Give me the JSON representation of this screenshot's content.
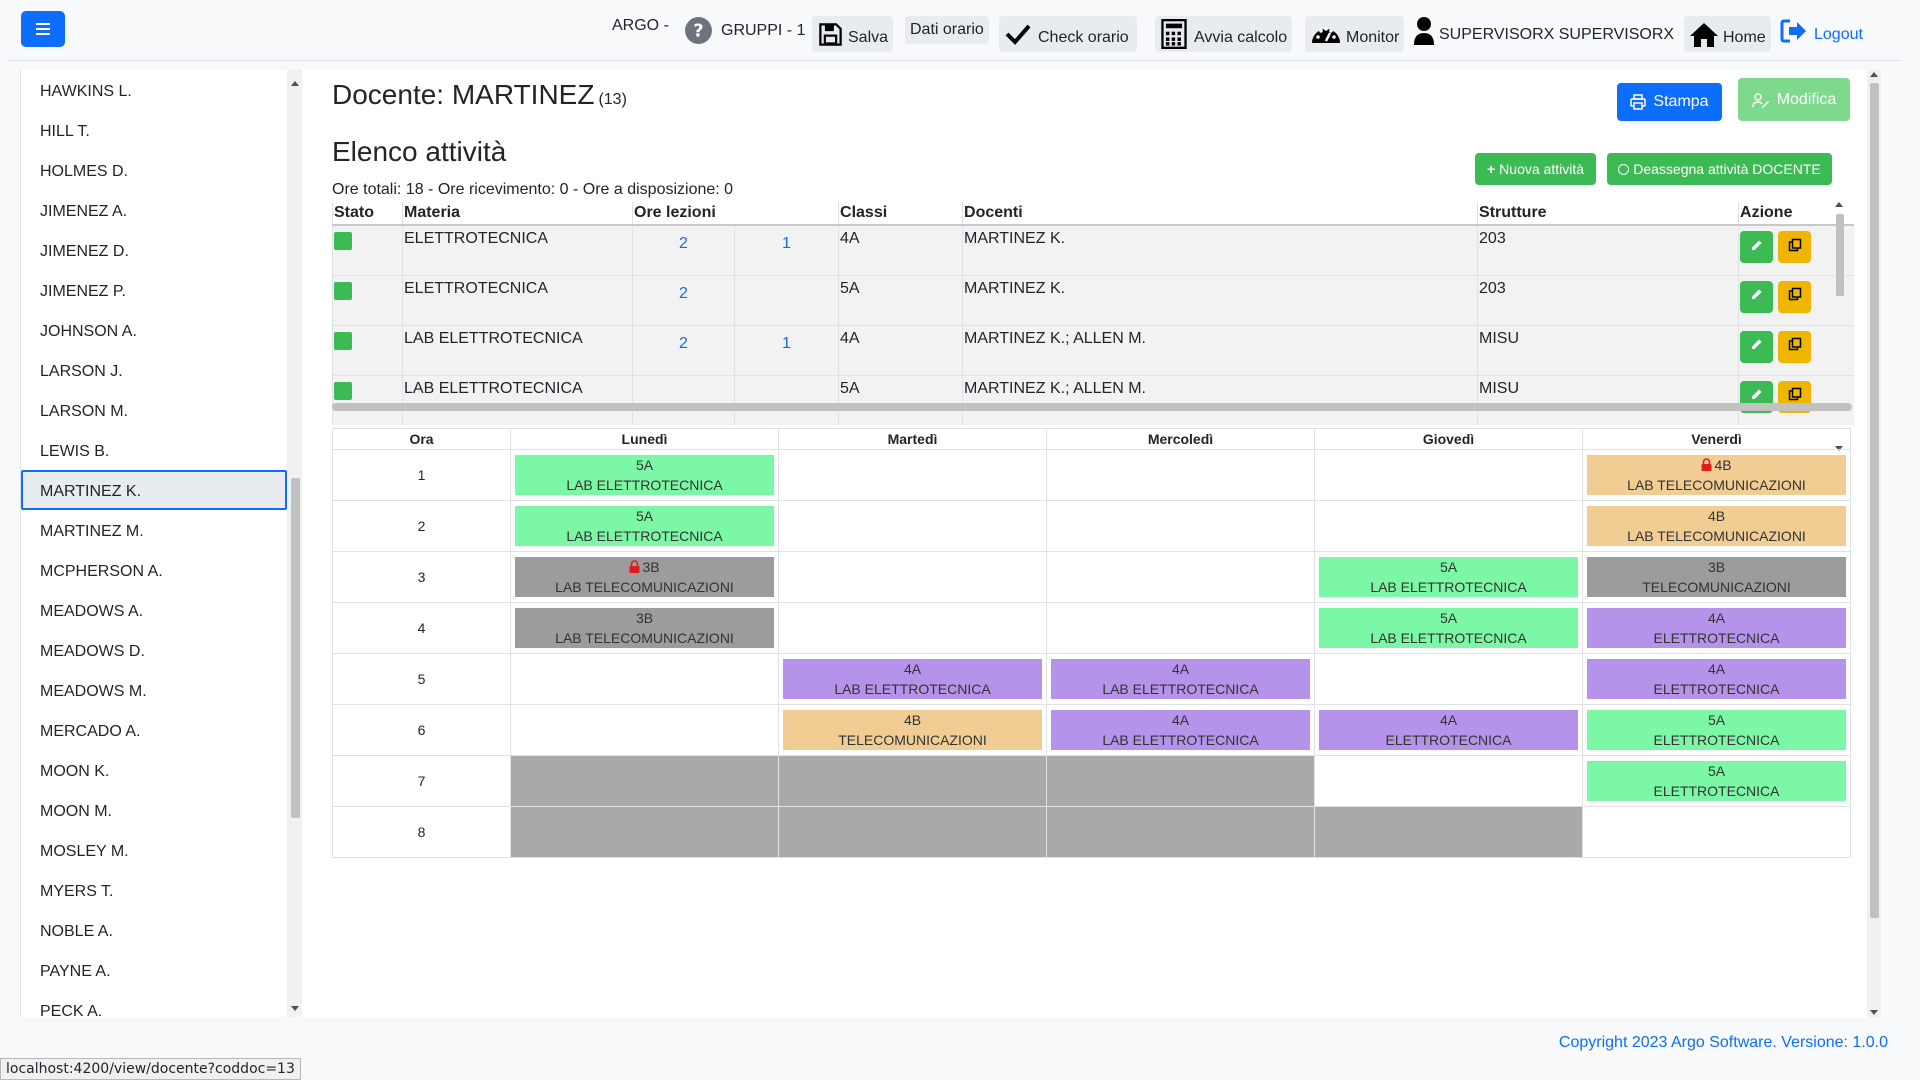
{
  "header": {
    "tenant": "ARGO -",
    "groups_label": "GRUPPI - 1",
    "save": "Salva",
    "timetable_data": "Dati orario",
    "check": "Check orario",
    "compute": "Avvia calcolo",
    "monitor": "Monitor",
    "user": "SUPERVISORX SUPERVISORX",
    "home": "Home",
    "logout": "Logout"
  },
  "sidebar": {
    "items": [
      "HAWKINS L.",
      "HILL T.",
      "HOLMES D.",
      "JIMENEZ A.",
      "JIMENEZ D.",
      "JIMENEZ P.",
      "JOHNSON A.",
      "LARSON J.",
      "LARSON M.",
      "LEWIS B.",
      "MARTINEZ K.",
      "MARTINEZ M.",
      "MCPHERSON A.",
      "MEADOWS A.",
      "MEADOWS D.",
      "MEADOWS M.",
      "MERCADO A.",
      "MOON K.",
      "MOON M.",
      "MOSLEY M.",
      "MYERS T.",
      "NOBLE A.",
      "PAYNE A.",
      "PECK A."
    ],
    "active": "MARTINEZ K."
  },
  "page": {
    "title": "Docente: MARTINEZ",
    "code": "(13)",
    "print": "Stampa",
    "edit": "Modifica",
    "section": "Elenco attività",
    "summary": "Ore totali: 18 - Ore ricevimento: 0 - Ore a disposizione: 0",
    "new_activity": "Nuova attività",
    "unassign": "Deassegna attività DOCENTE"
  },
  "activities": {
    "headers": [
      "Stato",
      "Materia",
      "Ore lezioni",
      "Classi",
      "Docenti",
      "Strutture",
      "Azione"
    ],
    "rows": [
      {
        "materia": "ELETTROTECNICA",
        "ore1": "2",
        "ore2": "1",
        "classe": "4A",
        "docenti": "MARTINEZ K.",
        "strutture": "203"
      },
      {
        "materia": "ELETTROTECNICA",
        "ore1": "2",
        "ore2": "",
        "classe": "5A",
        "docenti": "MARTINEZ K.",
        "strutture": "203"
      },
      {
        "materia": "LAB ELETTROTECNICA",
        "ore1": "2",
        "ore2": "1",
        "classe": "4A",
        "docenti": "MARTINEZ K.; ALLEN M.",
        "strutture": "MISU"
      },
      {
        "materia": "LAB ELETTROTECNICA",
        "ore1": "",
        "ore2": "",
        "classe": "5A",
        "docenti": "MARTINEZ K.; ALLEN M.",
        "strutture": "MISU"
      }
    ]
  },
  "schedule": {
    "hour_label": "Ora",
    "days": [
      "Lunedì",
      "Martedì",
      "Mercoledì",
      "Giovedì",
      "Venerdì"
    ],
    "hours": [
      "1",
      "2",
      "3",
      "4",
      "5",
      "6",
      "7",
      "8"
    ],
    "colors": {
      "green": "#7cf7a6",
      "orange": "#f2cd93",
      "gray": "#9e9b9e",
      "purple": "#b593ea",
      "blocked": "#a9a9a9"
    },
    "cells": [
      [
        {
          "c": "5A",
          "s": "LAB ELETTROTECNICA",
          "color": "green"
        },
        null,
        null,
        null,
        {
          "c": "4B",
          "s": "LAB TELECOMUNICAZIONI",
          "color": "orange",
          "lock": true
        }
      ],
      [
        {
          "c": "5A",
          "s": "LAB ELETTROTECNICA",
          "color": "green"
        },
        null,
        null,
        null,
        {
          "c": "4B",
          "s": "LAB TELECOMUNICAZIONI",
          "color": "orange"
        }
      ],
      [
        {
          "c": "3B",
          "s": "LAB TELECOMUNICAZIONI",
          "color": "gray",
          "lock": true
        },
        null,
        null,
        {
          "c": "5A",
          "s": "LAB ELETTROTECNICA",
          "color": "green"
        },
        {
          "c": "3B",
          "s": "TELECOMUNICAZIONI",
          "color": "gray"
        }
      ],
      [
        {
          "c": "3B",
          "s": "LAB TELECOMUNICAZIONI",
          "color": "gray"
        },
        null,
        null,
        {
          "c": "5A",
          "s": "LAB ELETTROTECNICA",
          "color": "green"
        },
        {
          "c": "4A",
          "s": "ELETTROTECNICA",
          "color": "purple"
        }
      ],
      [
        null,
        {
          "c": "4A",
          "s": "LAB ELETTROTECNICA",
          "color": "purple"
        },
        {
          "c": "4A",
          "s": "LAB ELETTROTECNICA",
          "color": "purple"
        },
        null,
        {
          "c": "4A",
          "s": "ELETTROTECNICA",
          "color": "purple"
        }
      ],
      [
        null,
        {
          "c": "4B",
          "s": "TELECOMUNICAZIONI",
          "color": "orange"
        },
        {
          "c": "4A",
          "s": "LAB ELETTROTECNICA",
          "color": "purple"
        },
        {
          "c": "4A",
          "s": "ELETTROTECNICA",
          "color": "purple"
        },
        {
          "c": "5A",
          "s": "ELETTROTECNICA",
          "color": "green"
        }
      ],
      [
        "blocked",
        "blocked",
        "blocked",
        null,
        {
          "c": "5A",
          "s": "ELETTROTECNICA",
          "color": "green"
        }
      ],
      [
        "blocked",
        "blocked",
        "blocked",
        "blocked",
        null
      ]
    ]
  },
  "footer": "Copyright 2023 Argo Software. Versione: 1.0.0",
  "status_url": "localhost:4200/view/docente?coddoc=13",
  "accent": "#0d6efd",
  "success": "#3cba54",
  "warning": "#f0b500"
}
